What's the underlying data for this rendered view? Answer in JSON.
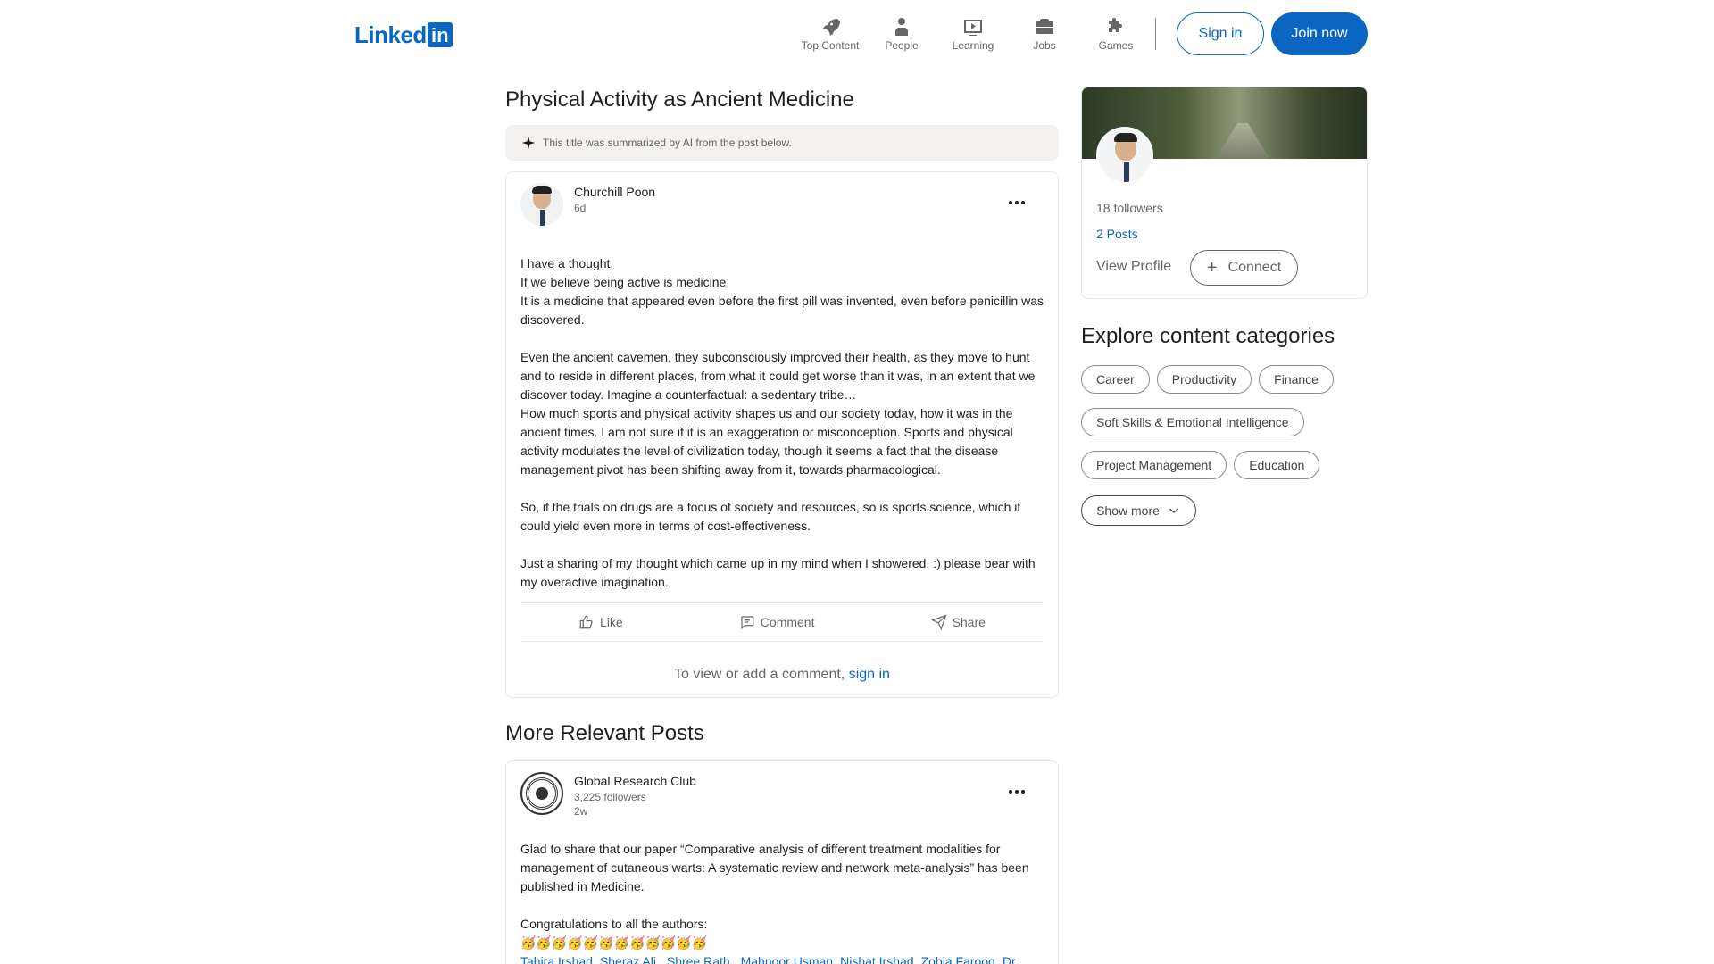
{
  "header": {
    "logo_text": "Linked",
    "logo_box": "in",
    "nav": [
      {
        "label": "Top Content",
        "icon": "rocket-icon"
      },
      {
        "label": "People",
        "icon": "people-icon"
      },
      {
        "label": "Learning",
        "icon": "learning-icon"
      },
      {
        "label": "Jobs",
        "icon": "briefcase-icon"
      },
      {
        "label": "Games",
        "icon": "puzzle-icon"
      }
    ],
    "sign_in": "Sign in",
    "join_now": "Join now"
  },
  "main": {
    "title": "Physical Activity as Ancient Medicine",
    "ai_note": "This title was summarized by AI from the post below.",
    "post": {
      "author": "Churchill Poon",
      "time": "6d",
      "paragraphs": [
        "I have a thought,\nIf we believe being active is medicine,\nIt is a medicine that appeared even before the first pill was invented, even before penicillin was discovered.",
        "Even the ancient cavemen, they subconsciously improved their health, as they move to hunt and to reside in different places, from what it could get worse than it was, in an extent that we discover today. Imagine a counterfactual: a sedentary tribe…\nHow much sports and physical activity shapes us and our society today, how it was in the ancient times. I am not sure if it is an exaggeration or misconception. Sports and physical activity modulates the level of civilization today, though it seems a fact that the disease management pivot has been shifting away from it, towards pharmacological.",
        "So, if the trials on drugs are a focus of society and resources, so is sports science, which it could yield even more in terms of cost-effectiveness.",
        "Just a sharing of my thought which came up in my mind when I showered. :) please bear with my overactive imagination."
      ],
      "actions": {
        "like": "Like",
        "comment": "Comment",
        "share": "Share"
      },
      "comment_prompt": "To view or add a comment,",
      "comment_link": "sign in"
    },
    "more_title": "More Relevant Posts",
    "related": {
      "author": "Global Research Club",
      "followers": "3,225 followers",
      "time": "2w",
      "p1": "Glad to share that our paper “Comparative analysis of different treatment modalities for management of cutaneous warts: A systematic review and network meta-analysis” has been published in Medicine.",
      "p2": "Congratulations to all the authors:",
      "emojis": "🥳🥳🥳🥳🥳🥳🥳🥳🥳🥳🥳🥳",
      "tags": [
        "Tahira Irshad",
        "Sheraz Ali",
        " Shree Rath",
        " Mahnoor Usman",
        "Nishat Irshad",
        "Zobia Farooq",
        "Dr Abdullah"
      ]
    }
  },
  "sidebar": {
    "followers": "18 followers",
    "posts": "2 Posts",
    "view_profile": "View Profile",
    "connect": "Connect",
    "explore_title": "Explore content categories",
    "categories": [
      "Career",
      "Productivity",
      "Finance",
      "Soft Skills & Emotional Intelligence",
      "Project Management",
      "Education"
    ],
    "show_more": "Show more"
  },
  "colors": {
    "brand": "#0a66c2",
    "text": "#1f1f1f",
    "muted": "#666666"
  }
}
